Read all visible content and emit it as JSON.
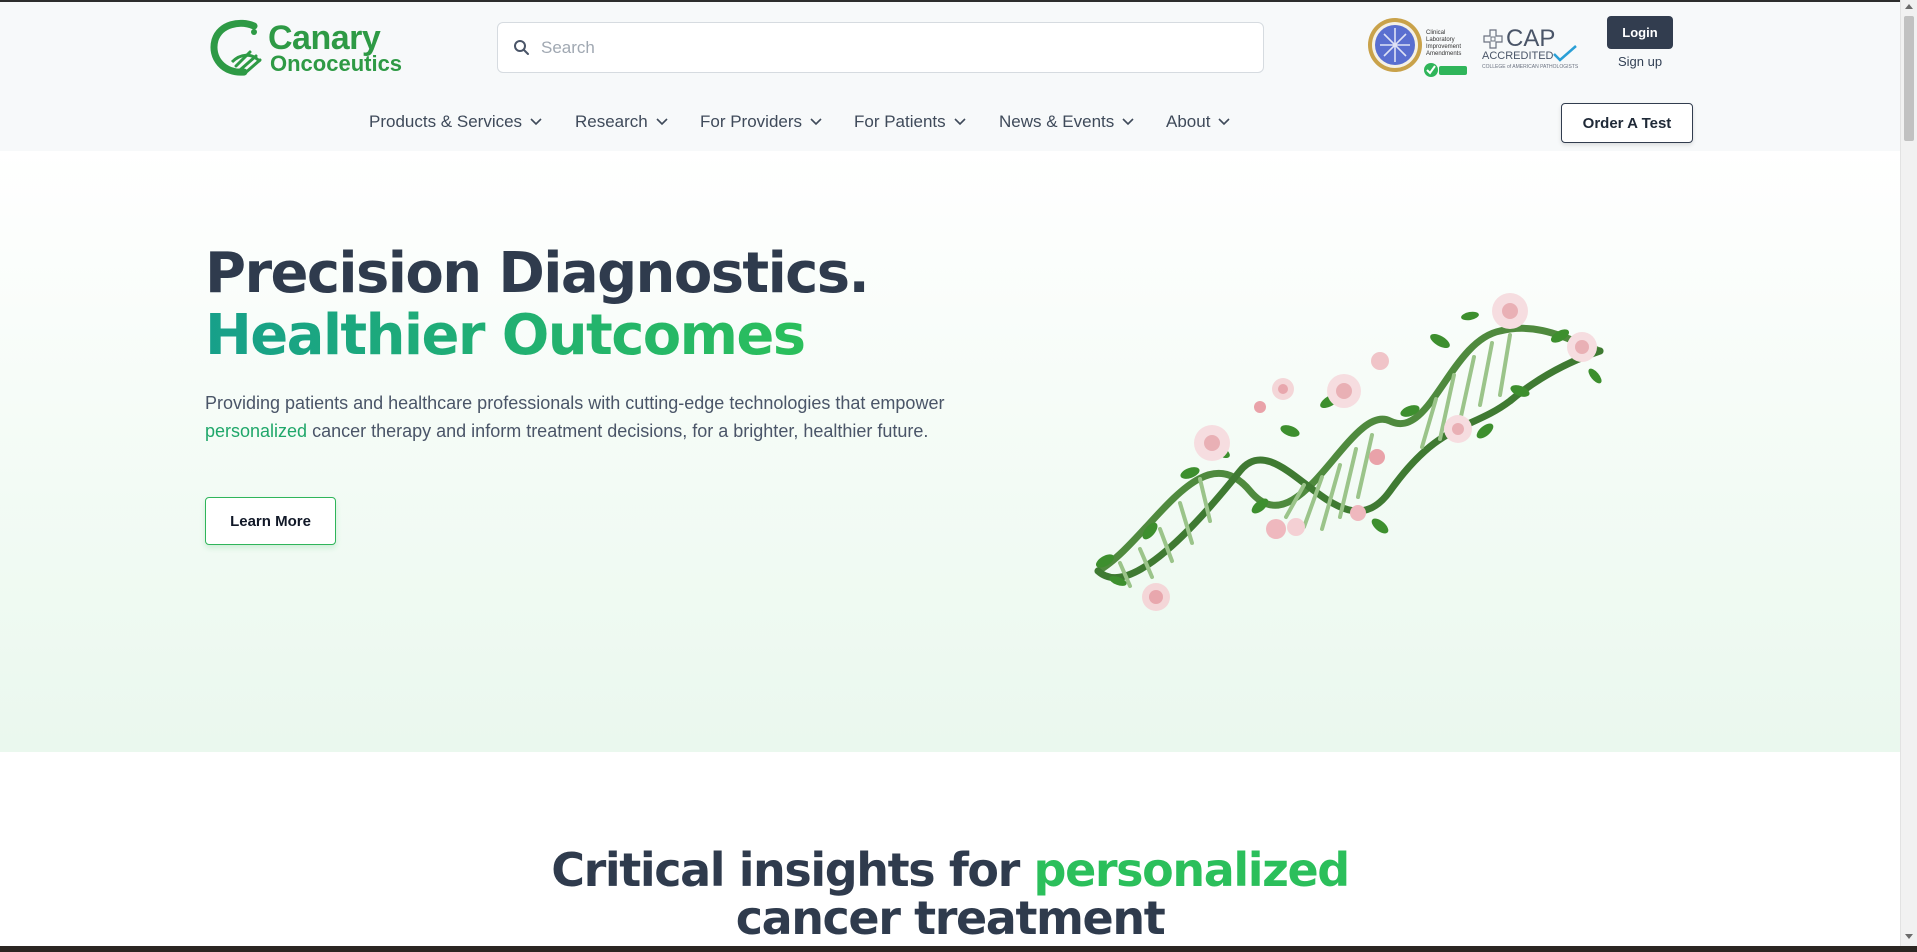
{
  "brand": {
    "line1": "Canary",
    "line2": "Oncoceutics"
  },
  "search": {
    "placeholder": "Search"
  },
  "badges": {
    "cap_title": "CAP",
    "cap_accredited": "ACCREDITED",
    "cap_subtitle": "COLLEGE of AMERICAN PATHOLOGISTS"
  },
  "auth": {
    "login_label": "Login",
    "signup_label": "Sign up"
  },
  "nav": {
    "items": [
      {
        "label": "Products & Services"
      },
      {
        "label": "Research"
      },
      {
        "label": "For Providers"
      },
      {
        "label": "For Patients"
      },
      {
        "label": "News & Events"
      },
      {
        "label": "About"
      }
    ],
    "order_label": "Order A Test"
  },
  "hero": {
    "title_line1": "Precision Diagnostics.",
    "title_line2": "Healthier Outcomes",
    "body_before": "Providing patients and healthcare professionals with cutting-edge technologies that empower ",
    "body_accent": "personalized",
    "body_after": " cancer therapy and inform treatment decisions, for a brighter, healthier future.",
    "cta_label": "Learn More"
  },
  "section2": {
    "heading_part1": "Critical insights for ",
    "heading_accent": "personalized",
    "heading_part2": "cancer treatment"
  },
  "colors": {
    "brand_green": "#2e9a45",
    "accent_green": "#1fa76a",
    "navy": "#323d4f",
    "text": "#4a5568"
  }
}
